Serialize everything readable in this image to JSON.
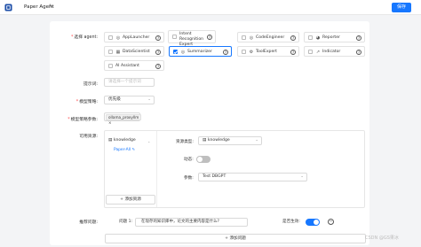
{
  "header": {
    "title": "Paper Agent",
    "save_label": "保存"
  },
  "agents": {
    "label": "选择 agent:",
    "items": [
      {
        "name": "AppLauncher",
        "checked": false,
        "icon": "app-icon"
      },
      {
        "name": "Intent Recognition Expert",
        "checked": false,
        "icon": "none"
      },
      {
        "name": "CodeEngineer",
        "checked": false,
        "icon": "code-icon"
      },
      {
        "name": "Reporter",
        "checked": false,
        "icon": "report-icon"
      },
      {
        "name": "DataScientist",
        "checked": false,
        "icon": "data-icon"
      },
      {
        "name": "Summarizer",
        "checked": true,
        "icon": "summarize-icon"
      },
      {
        "name": "ToolExpert",
        "checked": false,
        "icon": "tool-icon"
      },
      {
        "name": "Indicator",
        "checked": false,
        "icon": "indicator-icon"
      },
      {
        "name": "AI Assistant",
        "checked": false,
        "icon": "none"
      }
    ]
  },
  "prompt": {
    "label": "提示词:",
    "placeholder": "请选择一个提示词"
  },
  "model_strategy": {
    "label": "模型策略:",
    "value": "优先级"
  },
  "strategy_params": {
    "label": "模型策略参数:",
    "tag": "ollama_proxyllm",
    "tag_close": "×"
  },
  "resources": {
    "label": "可用资源:",
    "left_type": "knowledge",
    "left_item": "Paper-All",
    "type_label": "资源类型:",
    "type_value": "knowledge",
    "dynamic_label": "动态:",
    "params_label": "参数:",
    "params_value": "Test DBGPT",
    "add_label": "+ 添加资源"
  },
  "recommend": {
    "label": "推荐问题:",
    "prefix": "问题 1:",
    "question": "在现存的知识库中，论文的主要内容是什么?",
    "effective_label": "是否生效:",
    "add_label": "+ 添加问题"
  },
  "watermark": "CSDN @GS果冰"
}
